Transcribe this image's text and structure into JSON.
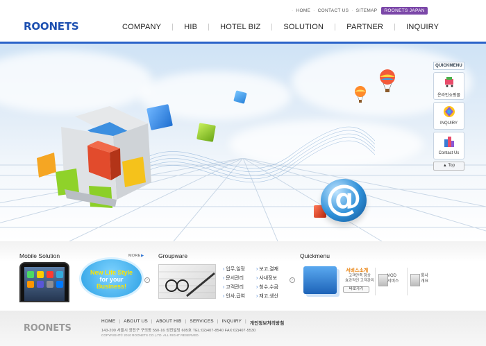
{
  "header": {
    "util_links": [
      "HOME",
      "CONTACT US",
      "SITEMAP"
    ],
    "util_badge": "ROONETS JAPAN",
    "logo": "ROONETS",
    "nav": [
      "COMPANY",
      "HIB",
      "HOTEL BIZ",
      "SOLUTION",
      "PARTNER",
      "INQUIRY"
    ]
  },
  "quickmenu": {
    "title": "QUICKMENU",
    "items": [
      {
        "label": "온라인쇼핑몰",
        "icon": "shopping-cart-icon"
      },
      {
        "label": "INQUIRY",
        "icon": "inquiry-icon"
      },
      {
        "label": "Contact Us",
        "icon": "building-icon"
      }
    ],
    "top_label": "▲ Top"
  },
  "mobile": {
    "title": "Mobile Solution",
    "more": "MORE",
    "bubble_line1": "New Life Style",
    "bubble_line2": "for your",
    "bubble_line3": "Business!"
  },
  "groupware": {
    "title": "Groupware",
    "col1": [
      "업무,일정",
      "문서관리",
      "고객관리",
      "인사,급여"
    ],
    "col2": [
      "보고,결재",
      "사내정보",
      "청수,수금",
      "재고,생산"
    ]
  },
  "quickmenu_section": {
    "title": "Quickmenu",
    "service_title": "서비스소개",
    "service_desc1": "고객만족 향상",
    "service_desc2": "효과적인 고객관리",
    "service_button": "바로가기",
    "vod_label1": "VOD",
    "vod_label2": "서비스",
    "company_label1": "회사",
    "company_label2": "개요"
  },
  "footer": {
    "logo": "ROONETS",
    "links": [
      "HOME",
      "ABOUT US",
      "ABOUT HIB",
      "SERVICES",
      "INQUIRY"
    ],
    "privacy": "개인정보처리방침",
    "address": "143-200 서울시 광진구 구의동 550-16 성진빌딩 605호 TEL:02)407-8540 FAX:02)407-5530",
    "copyright": "COPYRIGHT© 2010 ROONETS CO.,LTD. ALL RIGHT RESERVED."
  },
  "colors": {
    "brand_blue": "#1c4fb0",
    "accent_bar": "#2a63c9",
    "badge_purple": "#7b47a8"
  }
}
